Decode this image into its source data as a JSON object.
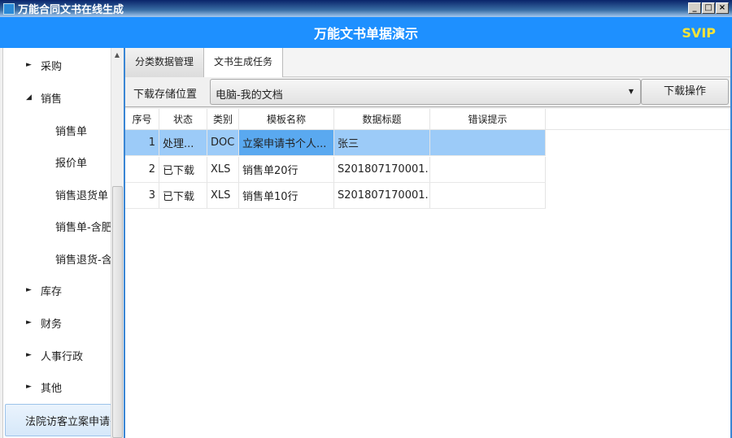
{
  "window": {
    "title": "万能合同文书在线生成",
    "buttons": [
      "_",
      "□",
      "×"
    ]
  },
  "header": {
    "title": "万能文书单据演示",
    "badge": "SVIP"
  },
  "sidebar": {
    "items": [
      {
        "label": "采购",
        "type": "collapsed"
      },
      {
        "label": "销售",
        "type": "expanded"
      },
      {
        "label": "销售单",
        "type": "child"
      },
      {
        "label": "报价单",
        "type": "child"
      },
      {
        "label": "销售退货单",
        "type": "child"
      },
      {
        "label": "销售单-含肥",
        "type": "child"
      },
      {
        "label": "销售退货-含",
        "type": "child"
      },
      {
        "label": "库存",
        "type": "collapsed"
      },
      {
        "label": "财务",
        "type": "collapsed"
      },
      {
        "label": "人事行政",
        "type": "collapsed"
      },
      {
        "label": "其他",
        "type": "collapsed"
      },
      {
        "label": "法院访客立案申请书",
        "type": "selected"
      }
    ]
  },
  "tabs": [
    {
      "label": "分类数据管理",
      "active": false
    },
    {
      "label": "文书生成任务",
      "active": true
    }
  ],
  "toolbar": {
    "location_label": "下载存储位置",
    "location_value": "电脑-我的文档",
    "download_button": "下载操作"
  },
  "table": {
    "columns": [
      "序号",
      "状态",
      "类别",
      "模板名称",
      "数据标题",
      "错误提示"
    ],
    "rows": [
      [
        "1",
        "处理...",
        "DOC",
        "立案申请书个人...",
        "张三",
        ""
      ],
      [
        "2",
        "已下载",
        "XLS",
        "销售单20行",
        "S201807170001...",
        ""
      ],
      [
        "3",
        "已下载",
        "XLS",
        "销售单10行",
        "S201807170001...",
        ""
      ]
    ],
    "selected_row": 0
  }
}
